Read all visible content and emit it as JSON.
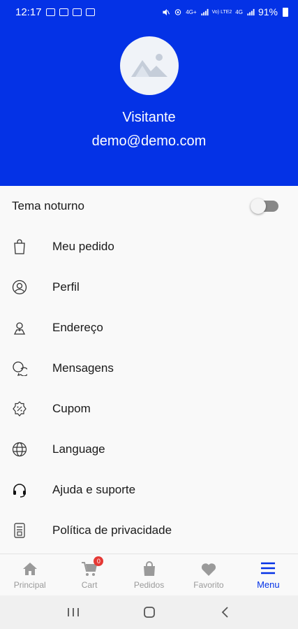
{
  "status_bar": {
    "time": "12:17",
    "network": "4G+",
    "network2": "Vo) LTE2",
    "network3": "4G",
    "battery": "91%"
  },
  "profile": {
    "name": "Visitante",
    "email": "demo@demo.com"
  },
  "theme": {
    "label": "Tema noturno",
    "enabled": false
  },
  "menu": {
    "items": [
      {
        "label": "Meu pedido",
        "icon": "shopping-bag-icon"
      },
      {
        "label": "Perfil",
        "icon": "user-icon"
      },
      {
        "label": "Endereço",
        "icon": "location-icon"
      },
      {
        "label": "Mensagens",
        "icon": "chat-icon"
      },
      {
        "label": "Cupom",
        "icon": "coupon-icon"
      },
      {
        "label": "Language",
        "icon": "globe-icon"
      },
      {
        "label": "Ajuda e suporte",
        "icon": "headset-icon"
      },
      {
        "label": "Política de privacidade",
        "icon": "document-icon"
      }
    ]
  },
  "bottom_nav": {
    "items": [
      {
        "label": "Principal",
        "icon": "home-icon"
      },
      {
        "label": "Cart",
        "icon": "cart-icon",
        "badge": "0"
      },
      {
        "label": "Pedidos",
        "icon": "bag-icon"
      },
      {
        "label": "Favorito",
        "icon": "heart-icon"
      },
      {
        "label": "Menu",
        "icon": "menu-icon",
        "active": true
      }
    ]
  },
  "colors": {
    "primary": "#0432e6",
    "inactive": "#9a9a9a",
    "badge": "#e53935"
  }
}
